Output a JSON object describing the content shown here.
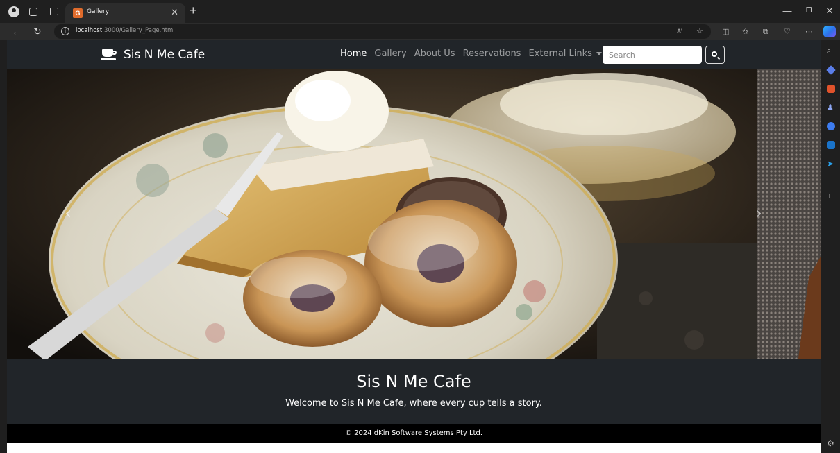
{
  "browser": {
    "tab_title": "Gallery",
    "tab_favicon_letter": "G",
    "url_host": "localhost",
    "url_path": ":3000/Gallery_Page.html",
    "read_aloud_label": "Aʹ",
    "icons": [
      "profile-icon",
      "workspaces-icon",
      "tab-actions-icon",
      "close-icon",
      "new-tab-icon",
      "back-icon",
      "reload-icon",
      "info-icon",
      "favorite-star-icon",
      "split-screen-icon",
      "favorites-icon",
      "collections-icon",
      "performance-icon",
      "more-icon",
      "copilot-icon"
    ],
    "accent_color": "#e06b2b"
  },
  "nav": {
    "brand": "Sis N Me Cafe",
    "links": [
      "Home",
      "Gallery",
      "About Us",
      "Reservations",
      "External Links"
    ],
    "active_link": "Home",
    "search_placeholder": "Search"
  },
  "carousel": {
    "prev_label": "‹",
    "next_label": "›"
  },
  "hero": {
    "title": "Sis N Me Cafe",
    "subtitle": "Welcome to Sis N Me Cafe, where every cup tells a story."
  },
  "footer": {
    "text": "© 2024 dKin Software Systems Pty Ltd."
  },
  "colors": {
    "navbar_bg": "#212529",
    "footer_bg": "#000000",
    "chrome_bg": "#1f1f1f"
  }
}
